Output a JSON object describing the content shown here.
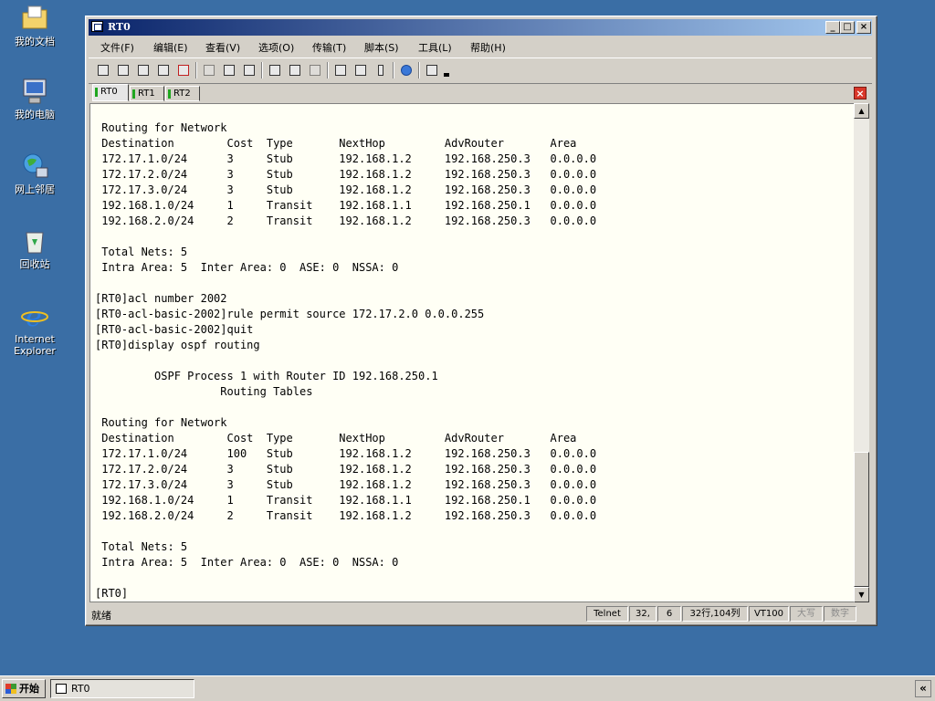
{
  "desktop": {
    "icons": [
      {
        "label": "我的文档"
      },
      {
        "label": "我的电脑"
      },
      {
        "label": "网上邻居"
      },
      {
        "label": "回收站"
      },
      {
        "label": "Internet Explorer"
      }
    ]
  },
  "window": {
    "title": "RT0",
    "controls": {
      "minimize": "_",
      "maximize": "□",
      "close": "×"
    },
    "menu": [
      "文件(F)",
      "编辑(E)",
      "查看(V)",
      "选项(O)",
      "传输(T)",
      "脚本(S)",
      "工具(L)",
      "帮助(H)"
    ],
    "tabs": [
      {
        "label": "RT0",
        "active": true
      },
      {
        "label": "RT1",
        "active": false
      },
      {
        "label": "RT2",
        "active": false
      }
    ],
    "tab_close": "×"
  },
  "terminal": {
    "lines": [
      " Routing for Network",
      " Destination        Cost  Type       NextHop         AdvRouter       Area",
      " 172.17.1.0/24      3     Stub       192.168.1.2     192.168.250.3   0.0.0.0",
      " 172.17.2.0/24      3     Stub       192.168.1.2     192.168.250.3   0.0.0.0",
      " 172.17.3.0/24      3     Stub       192.168.1.2     192.168.250.3   0.0.0.0",
      " 192.168.1.0/24     1     Transit    192.168.1.1     192.168.250.1   0.0.0.0",
      " 192.168.2.0/24     2     Transit    192.168.1.2     192.168.250.3   0.0.0.0",
      "",
      " Total Nets: 5",
      " Intra Area: 5  Inter Area: 0  ASE: 0  NSSA: 0",
      "",
      "[RT0]acl number 2002",
      "[RT0-acl-basic-2002]rule permit source 172.17.2.0 0.0.0.255",
      "[RT0-acl-basic-2002]quit",
      "[RT0]display ospf routing",
      "",
      "         OSPF Process 1 with Router ID 192.168.250.1",
      "                   Routing Tables",
      "",
      " Routing for Network",
      " Destination        Cost  Type       NextHop         AdvRouter       Area",
      " 172.17.1.0/24      100   Stub       192.168.1.2     192.168.250.3   0.0.0.0",
      " 172.17.2.0/24      3     Stub       192.168.1.2     192.168.250.3   0.0.0.0",
      " 172.17.3.0/24      3     Stub       192.168.1.2     192.168.250.3   0.0.0.0",
      " 192.168.1.0/24     1     Transit    192.168.1.1     192.168.250.1   0.0.0.0",
      " 192.168.2.0/24     2     Transit    192.168.1.2     192.168.250.3   0.0.0.0",
      "",
      " Total Nets: 5",
      " Intra Area: 5  Inter Area: 0  ASE: 0  NSSA: 0",
      "",
      "[RT0]"
    ]
  },
  "statusbar": {
    "status": "就绪",
    "protocol": "Telnet",
    "row": "32,",
    "col": "6",
    "dimensions": "32行,104列",
    "emulation": "VT100",
    "caps": "大写",
    "num": "数字"
  },
  "taskbar": {
    "start_label": "开始",
    "task_label": "RT0",
    "tray_label": "«"
  }
}
